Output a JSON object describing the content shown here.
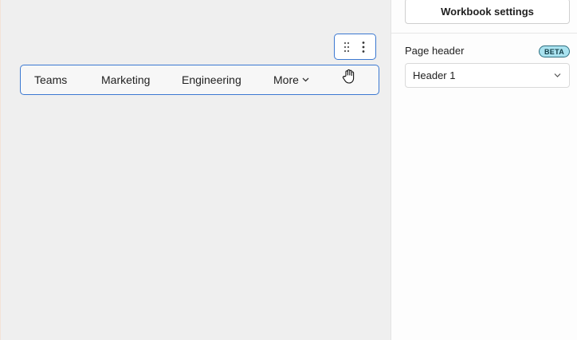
{
  "canvas": {
    "nav": {
      "items": [
        {
          "label": "Teams"
        },
        {
          "label": "Marketing"
        },
        {
          "label": "Engineering"
        },
        {
          "label": "More"
        }
      ]
    },
    "toolbar": {
      "icons": [
        "drag-handle-icon",
        "more-vertical-icon"
      ]
    },
    "cursor": "hand-grab-icon"
  },
  "panel": {
    "workbook_settings_label": "Workbook settings",
    "page_header": {
      "label": "Page header",
      "badge": "BETA",
      "selected": "Header 1"
    }
  },
  "colors": {
    "selection_border": "#3b78d1",
    "canvas_bg": "#efefef",
    "badge_bg": "#a9e2ef"
  }
}
